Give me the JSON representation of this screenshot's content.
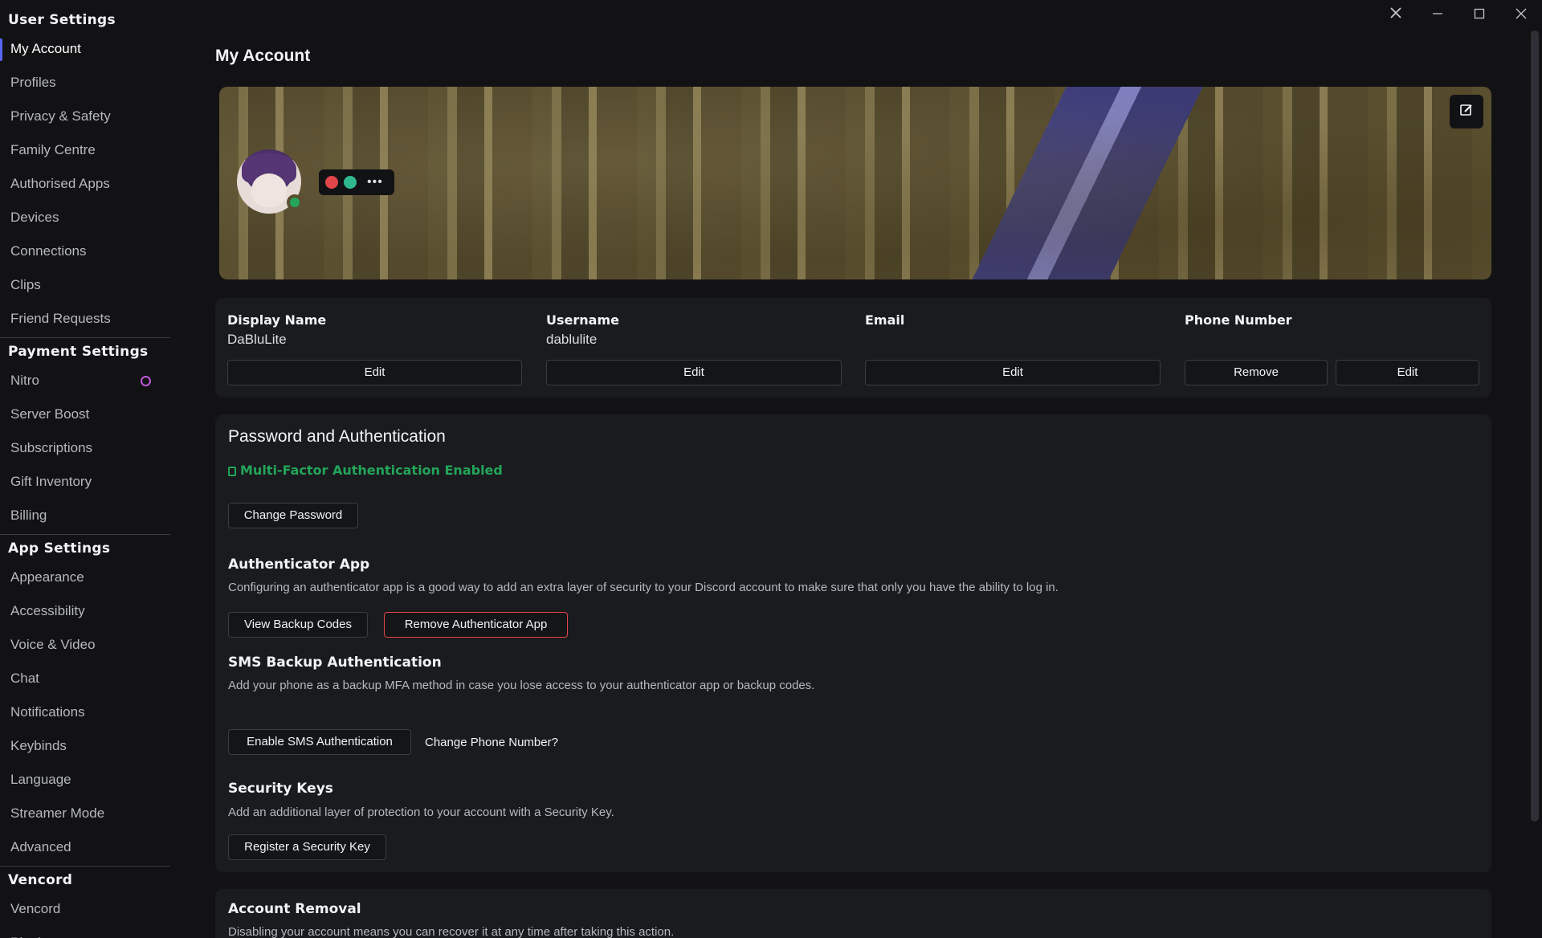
{
  "window": {
    "close_icon": "close-icon",
    "minimize_icon": "minimize-icon",
    "maximize_icon": "maximize-icon"
  },
  "sidebar": {
    "groups": [
      {
        "heading": "User Settings",
        "items": [
          "My Account",
          "Profiles",
          "Privacy & Safety",
          "Family Centre",
          "Authorised Apps",
          "Devices",
          "Connections",
          "Clips",
          "Friend Requests"
        ]
      },
      {
        "heading": "Payment Settings",
        "items": [
          "Nitro",
          "Server Boost",
          "Subscriptions",
          "Gift Inventory",
          "Billing"
        ]
      },
      {
        "heading": "App Settings",
        "items": [
          "Appearance",
          "Accessibility",
          "Voice & Video",
          "Chat",
          "Notifications",
          "Keybinds",
          "Language",
          "Streamer Mode",
          "Advanced"
        ]
      },
      {
        "heading": "Vencord",
        "items": [
          "Vencord",
          "Plugins"
        ]
      }
    ],
    "active_item": "My Account"
  },
  "main": {
    "title": "My Account",
    "profile": {
      "badges": [
        "heart-badge",
        "hash-badge"
      ],
      "more_label": "•••",
      "status": "online",
      "status_color": "#23a55a"
    },
    "fields": {
      "display_name": {
        "label": "Display Name",
        "value": "DaBluLite",
        "edit": "Edit"
      },
      "username": {
        "label": "Username",
        "value": "dablulite",
        "edit": "Edit"
      },
      "email": {
        "label": "Email",
        "value": "",
        "edit": "Edit"
      },
      "phone": {
        "label": "Phone Number",
        "value": "",
        "remove": "Remove",
        "edit": "Edit"
      }
    },
    "security": {
      "title": "Password and Authentication",
      "mfa_status": "Multi-Factor Authentication Enabled",
      "mfa_color": "#23a55a",
      "change_password": "Change Password",
      "auth_app": {
        "heading": "Authenticator App",
        "description": "Configuring an authenticator app is a good way to add an extra layer of security to your Discord account to make sure that only you have the ability to log in.",
        "view_codes": "View Backup Codes",
        "remove": "Remove Authenticator App"
      },
      "sms": {
        "heading": "SMS Backup Authentication",
        "description": "Add your phone as a backup MFA method in case you lose access to your authenticator app or backup codes.",
        "enable": "Enable SMS Authentication",
        "change_phone": "Change Phone Number?"
      },
      "keys": {
        "heading": "Security Keys",
        "description": "Add an additional layer of protection to your account with a Security Key.",
        "register": "Register a Security Key"
      }
    },
    "removal": {
      "heading": "Account Removal",
      "description": "Disabling your account means you can recover it at any time after taking this action."
    }
  }
}
